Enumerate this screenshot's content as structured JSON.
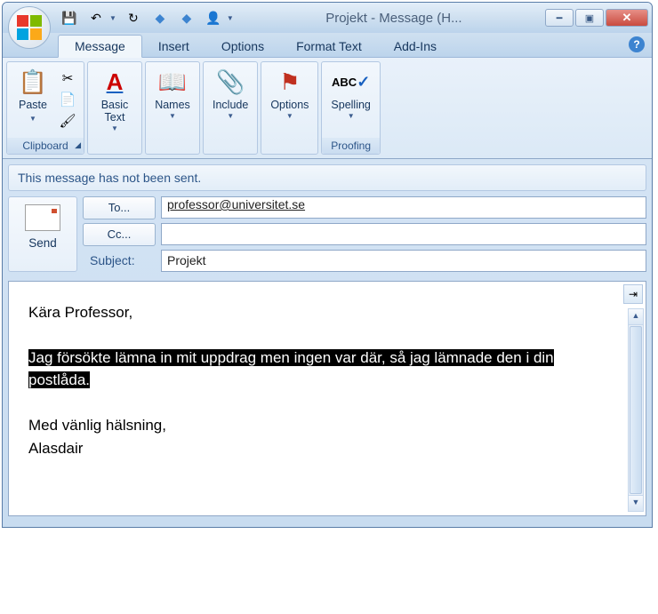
{
  "titlebar": {
    "title": "Projekt - Message (H..."
  },
  "tabs": {
    "message": "Message",
    "insert": "Insert",
    "options": "Options",
    "format": "Format Text",
    "addins": "Add-Ins"
  },
  "ribbon": {
    "clipboard": {
      "label": "Clipboard",
      "paste": "Paste"
    },
    "basictext": {
      "label": "Basic\nText"
    },
    "names": {
      "label": "Names"
    },
    "include": {
      "label": "Include"
    },
    "options": {
      "label": "Options"
    },
    "spelling": {
      "label": "Spelling",
      "group": "Proofing"
    }
  },
  "infobar": "This message has not been sent.",
  "send": "Send",
  "fields": {
    "to_btn": "To...",
    "to_value": "professor@universitet.se",
    "cc_btn": "Cc...",
    "cc_value": "",
    "subject_label": "Subject:",
    "subject_value": "Projekt"
  },
  "body": {
    "greeting": "Kära Professor,",
    "selected": "Jag försökte lämna in mit uppdrag men ingen var där, så jag lämnade den i din postlåda.",
    "signoff1": "Med vänlig hälsning,",
    "signoff2": "Alasdair"
  }
}
